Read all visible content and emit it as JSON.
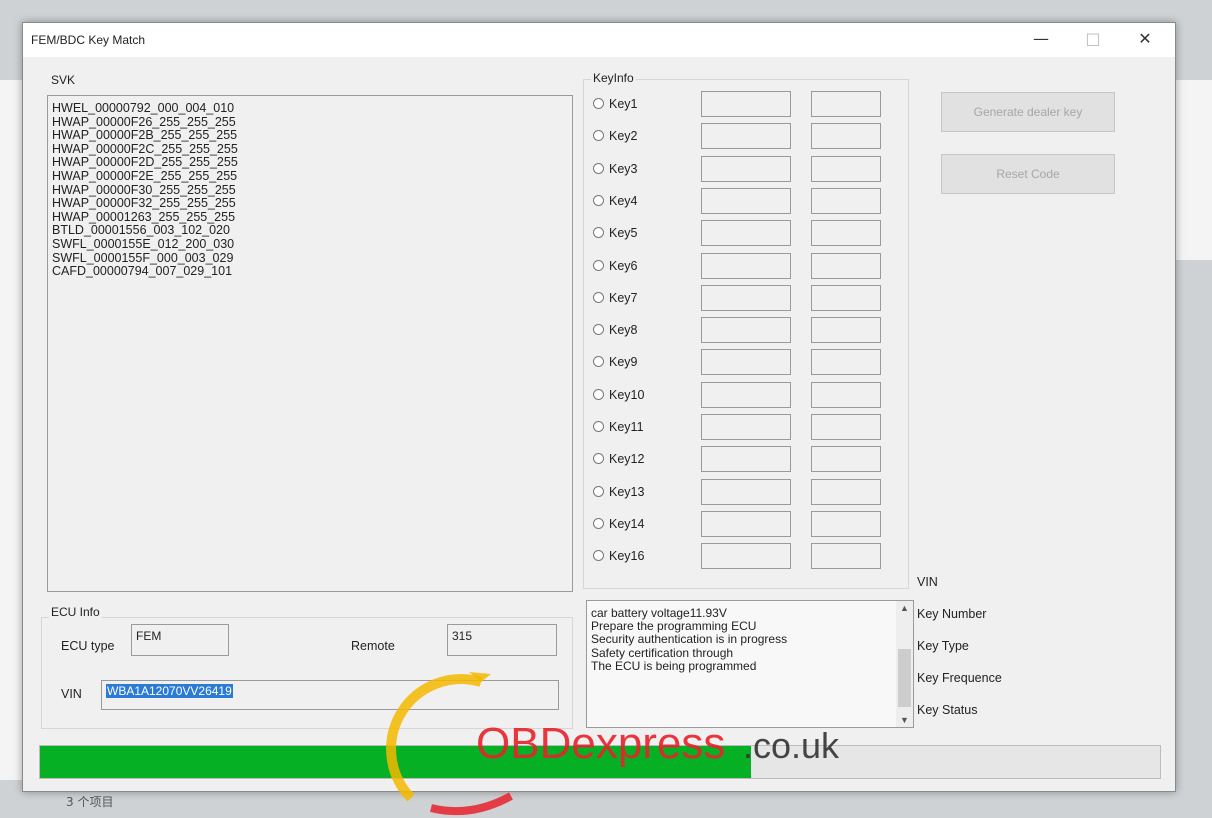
{
  "background": {
    "status_text": "3 个项目"
  },
  "window": {
    "title": "FEM/BDC Key Match",
    "controls": {
      "minimize": "—",
      "maximize": "□",
      "close": "✕"
    }
  },
  "svk": {
    "label": "SVK",
    "items": [
      "HWEL_00000792_000_004_010",
      "HWAP_00000F26_255_255_255",
      "HWAP_00000F2B_255_255_255",
      "HWAP_00000F2C_255_255_255",
      "HWAP_00000F2D_255_255_255",
      "HWAP_00000F2E_255_255_255",
      "HWAP_00000F30_255_255_255",
      "HWAP_00000F32_255_255_255",
      "HWAP_00001263_255_255_255",
      "BTLD_00001556_003_102_020",
      "SWFL_0000155E_012_200_030",
      "SWFL_0000155F_000_003_029",
      "CAFD_00000794_007_029_101"
    ]
  },
  "keyinfo": {
    "label": "KeyInfo",
    "keys": [
      "Key1",
      "Key2",
      "Key3",
      "Key4",
      "Key5",
      "Key6",
      "Key7",
      "Key8",
      "Key9",
      "Key10",
      "Key11",
      "Key12",
      "Key13",
      "Key14",
      "Key16"
    ]
  },
  "buttons": {
    "generate_dealer_key": "Generate dealer key",
    "reset_code": "Reset Code"
  },
  "ecu_info": {
    "label": "ECU Info",
    "ecu_type_label": "ECU type",
    "ecu_type_value": "FEM",
    "remote_label": "Remote",
    "remote_value": "315",
    "vin_label": "VIN",
    "vin_value": "WBA1A12070VV26419"
  },
  "log": {
    "lines": [
      "car battery voltage11.93V",
      "Prepare the programming ECU",
      "Security authentication is in progress",
      "Safety certification through",
      "The ECU is being programmed"
    ]
  },
  "key_details": {
    "labels": [
      "VIN",
      "Key Number",
      "Key Type",
      "Key Frequence",
      "Key Status"
    ]
  },
  "progress": {
    "value": 0.635,
    "color": "#06b025"
  },
  "watermark": {
    "text_main": "OBDexpress",
    "text_suffix": ".co.uk",
    "accent": "#f5b800",
    "brand": "#e8222b"
  }
}
